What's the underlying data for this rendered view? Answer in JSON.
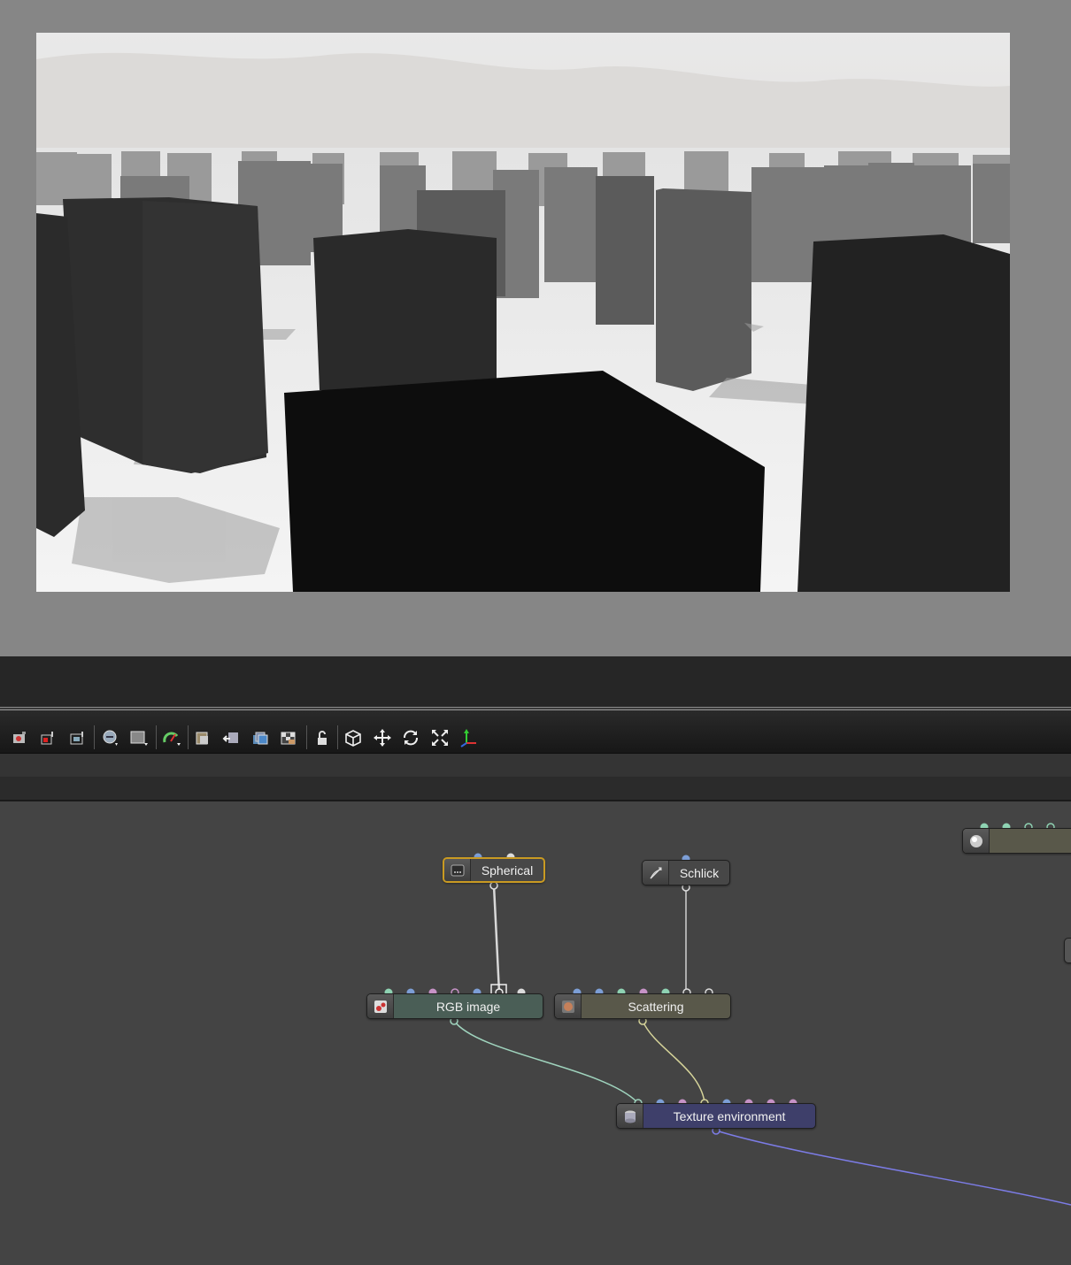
{
  "toolbar": {
    "buttons": [
      {
        "name": "camera-view-icon"
      },
      {
        "name": "film-region-icon"
      },
      {
        "name": "render-region-icon"
      },
      {
        "name": "picker-tool-icon"
      },
      {
        "name": "background-toggle-icon"
      },
      {
        "name": "render-priority-icon"
      },
      {
        "name": "copy-to-clipboard-icon"
      },
      {
        "name": "save-render-icon"
      },
      {
        "name": "export-passes-icon"
      },
      {
        "name": "alpha-checker-icon"
      },
      {
        "name": "lock-icon"
      },
      {
        "name": "cube-view-icon"
      },
      {
        "name": "move-icon"
      },
      {
        "name": "rotate-icon"
      },
      {
        "name": "fit-view-icon"
      },
      {
        "name": "axis-gizmo-icon"
      }
    ]
  },
  "graph": {
    "nodes": {
      "spherical": {
        "label": "Spherical",
        "icon": "projection-icon"
      },
      "schlick": {
        "label": "Schlick",
        "icon": "phase-function-icon"
      },
      "rgb_image": {
        "label": "RGB image",
        "icon": "image-texture-icon"
      },
      "scattering": {
        "label": "Scattering",
        "icon": "medium-icon"
      },
      "texture_environment": {
        "label": "Texture environment",
        "icon": "environment-icon"
      }
    },
    "colors": {
      "wire_white": "#d8d8d8",
      "wire_green": "#9fd3bd",
      "wire_yellow": "#d6d49a",
      "wire_blue": "#7c7ce6",
      "pin_green": "#8fd3b3",
      "pin_blue": "#7d9fd6",
      "pin_pink": "#c793c7",
      "pin_white": "#dcdcdc",
      "rgb_node": "#4a5e56",
      "scattering_node": "#59584a",
      "env_node": "#3e3f6a",
      "selected_border": "#c99a22"
    }
  }
}
